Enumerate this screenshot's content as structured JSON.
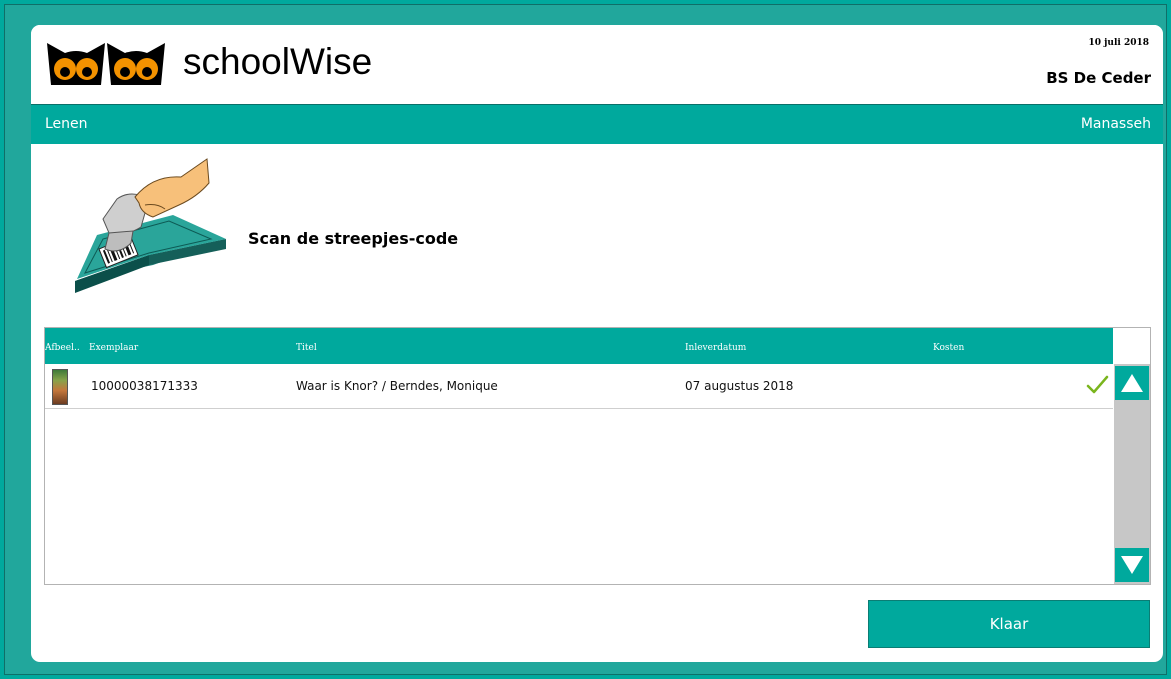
{
  "header": {
    "brand": "schoolWise",
    "date": "10 juli 2018",
    "school": "BS De Ceder"
  },
  "nav": {
    "section": "Lenen",
    "user": "Manasseh"
  },
  "instruction": "Scan de streepjes-code",
  "table": {
    "columns": [
      "Afbeel..",
      "Exemplaar",
      "Titel",
      "Inleverdatum",
      "Kosten"
    ],
    "rows": [
      {
        "image": "book-cover",
        "exemplaar": "10000038171333",
        "titel": "Waar is Knor? / Berndes, Monique",
        "inleverdatum": "07 augustus 2018",
        "kosten": "",
        "status": "check-icon"
      }
    ]
  },
  "buttons": {
    "done": "Klaar"
  },
  "colors": {
    "accent": "#00a99d",
    "logo_orange": "#f39200",
    "check_green": "#7ab51d"
  }
}
